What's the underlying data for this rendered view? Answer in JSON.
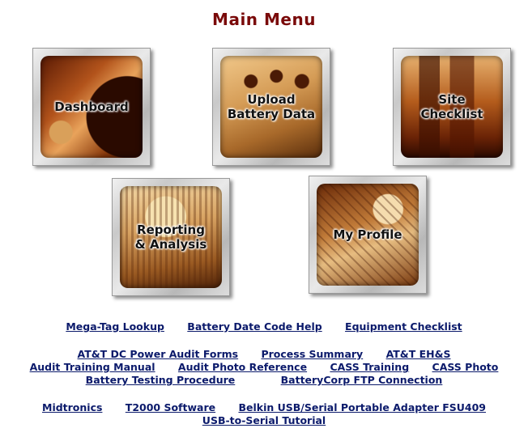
{
  "page": {
    "title": "Main Menu"
  },
  "tiles": [
    {
      "label": "Dashboard"
    },
    {
      "label": "Upload\nBattery Data"
    },
    {
      "label": "Site\nChecklist"
    },
    {
      "label": "Reporting\n& Analysis"
    },
    {
      "label": "My Profile"
    }
  ],
  "links": {
    "row1": [
      "Mega-Tag Lookup",
      "Battery Date Code Help",
      "Equipment Checklist"
    ],
    "row2": [
      "AT&T DC Power Audit Forms",
      "Process Summary",
      "AT&T EH&S"
    ],
    "row3": [
      "Audit Training Manual",
      "Audit Photo Reference",
      "CASS Training",
      "CASS Photo"
    ],
    "row4": [
      "Battery Testing Procedure",
      "BatteryCorp FTP Connection"
    ],
    "row5": [
      "Midtronics",
      "T2000 Software",
      "Belkin USB/Serial Portable Adapter FSU409"
    ],
    "row6": [
      "USB-to-Serial Tutorial"
    ]
  },
  "colors": {
    "title": "#7a0a0a",
    "link": "#0b1a6b"
  }
}
